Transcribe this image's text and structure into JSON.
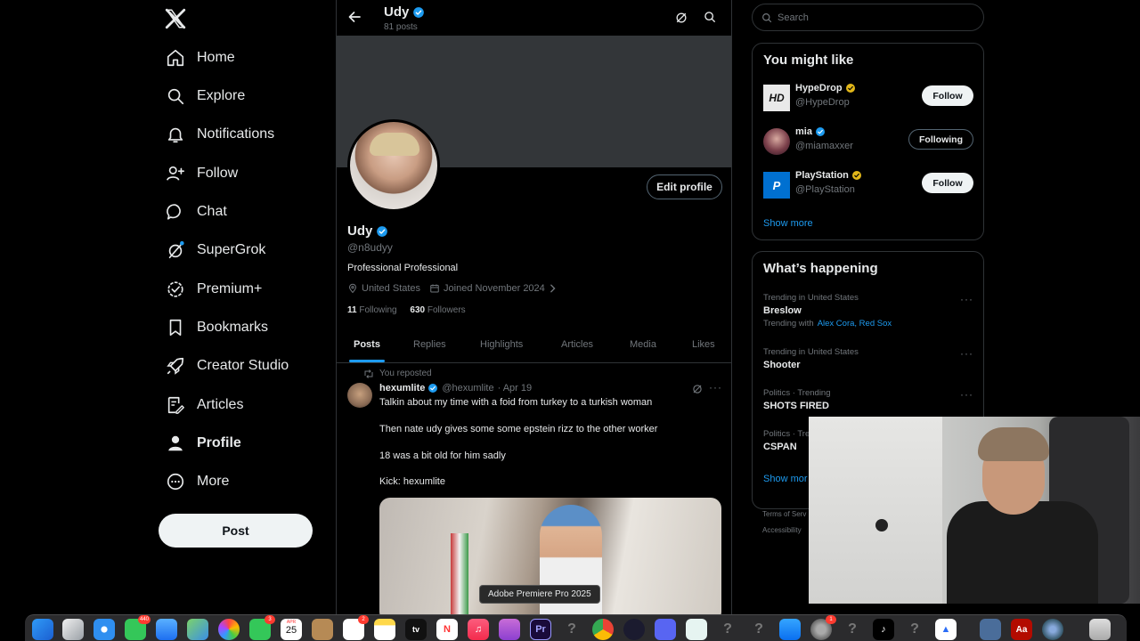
{
  "nav": {
    "items": [
      {
        "label": "Home",
        "icon": "home-icon"
      },
      {
        "label": "Explore",
        "icon": "search-icon"
      },
      {
        "label": "Notifications",
        "icon": "bell-icon"
      },
      {
        "label": "Follow",
        "icon": "person-add-icon"
      },
      {
        "label": "Chat",
        "icon": "chat-bubble-icon"
      },
      {
        "label": "SuperGrok",
        "icon": "grok-icon"
      },
      {
        "label": "Premium+",
        "icon": "verified-badge-icon"
      },
      {
        "label": "Bookmarks",
        "icon": "bookmark-icon"
      },
      {
        "label": "Creator Studio",
        "icon": "rocket-icon"
      },
      {
        "label": "Articles",
        "icon": "article-icon"
      },
      {
        "label": "Profile",
        "icon": "person-icon"
      },
      {
        "label": "More",
        "icon": "more-circle-icon"
      }
    ],
    "post_label": "Post"
  },
  "header": {
    "name": "Udy",
    "post_count": "81 posts"
  },
  "profile": {
    "edit_label": "Edit profile",
    "name": "Udy",
    "handle": "@n8udyy",
    "bio": "Professional Professional",
    "location": "United States",
    "joined": "Joined November 2024",
    "following_count": "11",
    "following_label": "Following",
    "followers_count": "630",
    "followers_label": "Followers"
  },
  "tabs": [
    "Posts",
    "Replies",
    "Highlights",
    "Articles",
    "Media",
    "Likes"
  ],
  "post": {
    "repost_label": "You reposted",
    "author": "hexumlite",
    "handle": "@hexumlite",
    "date": "· Apr 19",
    "lines": [
      "Talkin about my time with a foid from turkey to a turkish woman",
      "Then nate udy gives some some epstein rizz to the other worker",
      "18 was a bit old for him sadly",
      "Kick: hexumlite"
    ]
  },
  "tooltip": "Adobe Premiere Pro 2025",
  "search": {
    "placeholder": "Search"
  },
  "might_like": {
    "title": "You might like",
    "users": [
      {
        "name": "HypeDrop",
        "handle": "@HypeDrop",
        "button": "Follow"
      },
      {
        "name": "mia",
        "handle": "@miamaxxer",
        "button": "Following"
      },
      {
        "name": "PlayStation",
        "handle": "@PlayStation",
        "button": "Follow"
      }
    ],
    "show_more": "Show more"
  },
  "happening": {
    "title": "What’s happening",
    "trends": [
      {
        "context": "Trending in United States",
        "topic": "Breslow",
        "with_label": "Trending with",
        "with_links": "Alex Cora, Red Sox"
      },
      {
        "context": "Trending in United States",
        "topic": "Shooter"
      },
      {
        "context": "Politics · Trending",
        "topic": "SHOTS FIRED"
      },
      {
        "context": "Politics · Tre",
        "topic": "CSPAN"
      }
    ],
    "show_more": "Show mor"
  },
  "footer": {
    "line1": "Terms of Serv",
    "line2": "Accessibility"
  },
  "dock": {
    "messages_badge": "440",
    "facetime_badge": "3",
    "reminders_badge": "2",
    "settings_badge": "1",
    "calendar_month": "APR",
    "calendar_day": "25",
    "appletv_label": "tv",
    "premiere_label": "Pr",
    "acrobat_label": "Aa"
  },
  "colors": {
    "accent": "#1d9bf0",
    "gold": "#e2b719",
    "background": "#000000",
    "border": "#2f3336",
    "muted": "#71767b"
  }
}
